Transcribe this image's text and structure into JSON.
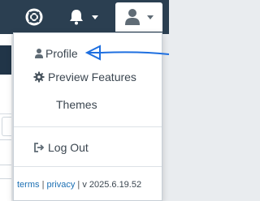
{
  "menu": {
    "items": [
      {
        "label": "Profile",
        "icon": "user-icon"
      },
      {
        "label": "Preview Features",
        "icon": "gear-icon"
      },
      {
        "label": "Themes",
        "icon": ""
      }
    ],
    "logout": {
      "label": "Log Out",
      "icon": "sign-out-icon"
    }
  },
  "footer": {
    "terms": "terms",
    "separator": "|",
    "privacy": "privacy",
    "version": "v 2025.6.19.52"
  },
  "colors": {
    "topbar": "#2b3f51",
    "annotation": "#1e6fe0",
    "link": "#1b6fb3",
    "icon_light": "#ffffff",
    "icon_dark": "#5f6b75"
  }
}
